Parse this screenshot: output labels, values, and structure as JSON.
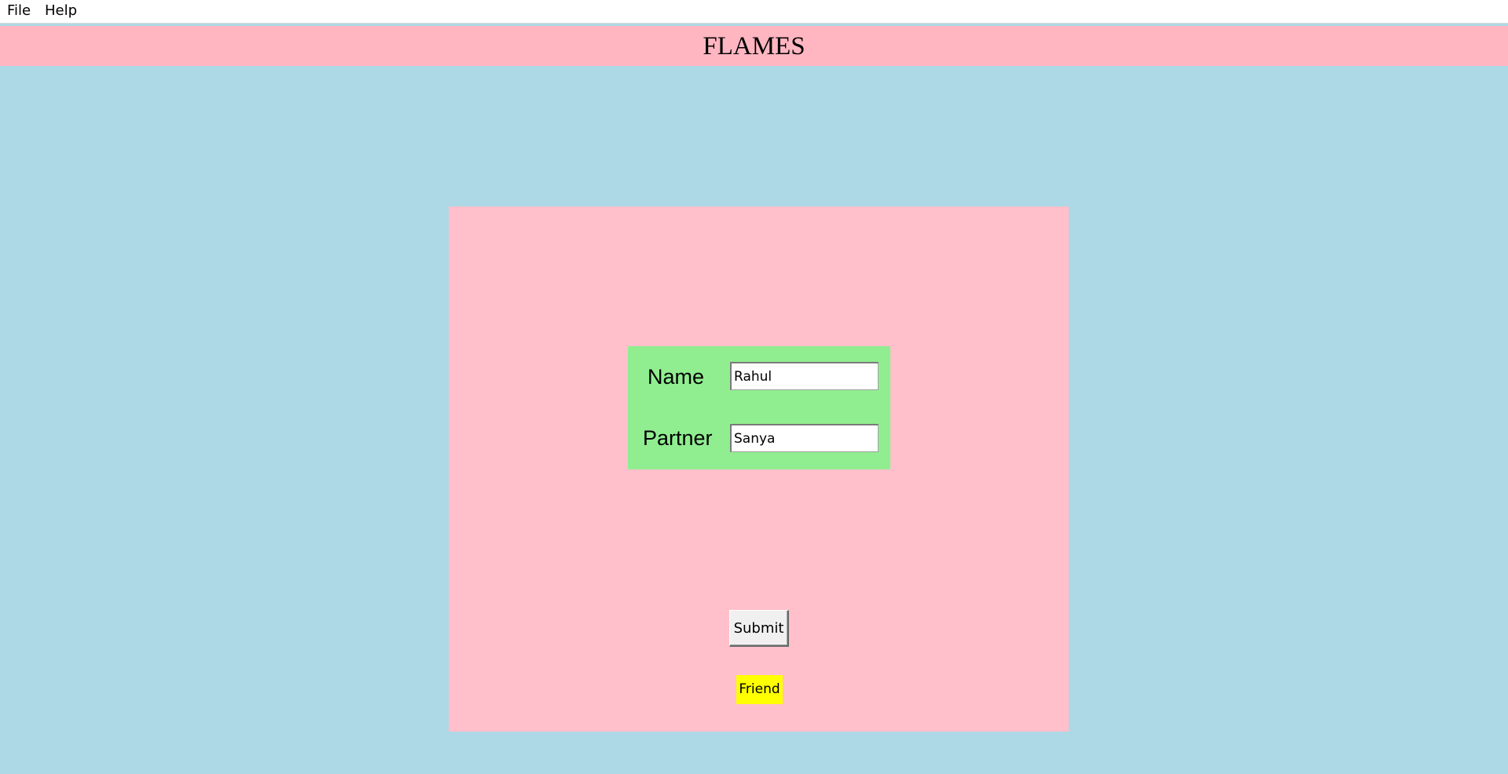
{
  "menu": {
    "file_label": "File",
    "help_label": "Help"
  },
  "header": {
    "title": "FLAMES"
  },
  "form": {
    "name_label": "Name",
    "name_value": "Rahul",
    "partner_label": "Partner",
    "partner_value": "Sanya"
  },
  "actions": {
    "submit_label": "Submit"
  },
  "result": {
    "text": "Friend"
  },
  "colors": {
    "window_background": "#add8e6",
    "title_background": "#ffb6c1",
    "panel_background": "#ffc0cb",
    "form_background": "#90ee90",
    "result_background": "#ffff00"
  }
}
